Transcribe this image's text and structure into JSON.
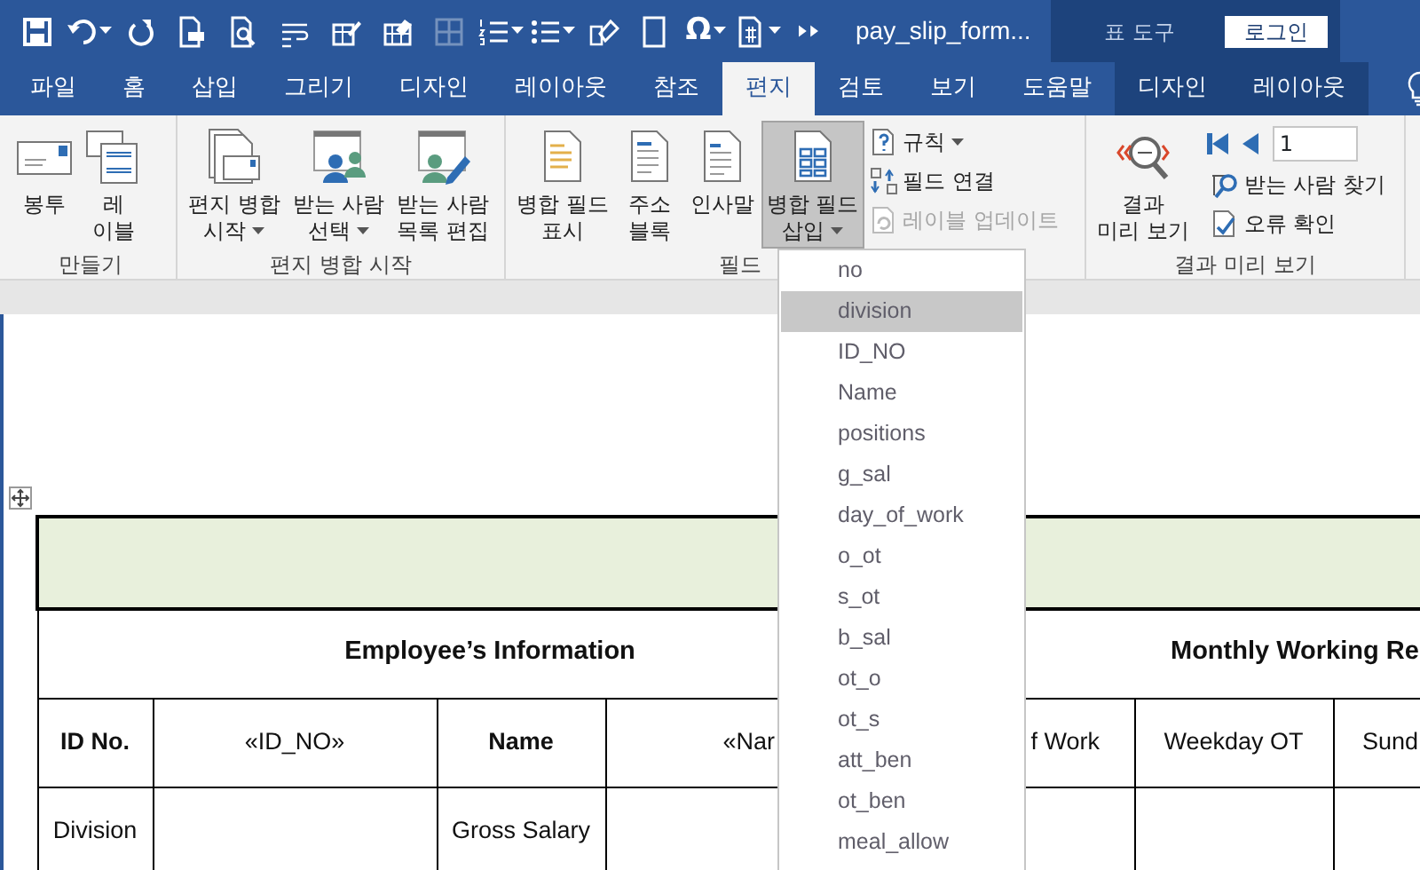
{
  "window": {
    "title": "pay_slip_form...",
    "context_label": "표 도구",
    "login_button": "로그인",
    "symbol_button": "Ω"
  },
  "quick_access": [
    {
      "kind": "save",
      "dropdown": false,
      "disabled": false
    },
    {
      "kind": "undo",
      "dropdown": true,
      "disabled": false
    },
    {
      "kind": "redo",
      "dropdown": false,
      "disabled": false
    },
    {
      "kind": "print-doc",
      "dropdown": false,
      "disabled": false
    },
    {
      "kind": "preview",
      "dropdown": false,
      "disabled": false
    },
    {
      "kind": "wrap",
      "dropdown": false,
      "disabled": false
    },
    {
      "kind": "table-pen",
      "dropdown": false,
      "disabled": false
    },
    {
      "kind": "table-eraser",
      "dropdown": false,
      "disabled": false
    },
    {
      "kind": "table-grid",
      "dropdown": false,
      "disabled": true
    },
    {
      "kind": "numbered-list",
      "dropdown": true,
      "disabled": false
    },
    {
      "kind": "bullet-list",
      "dropdown": true,
      "disabled": false
    },
    {
      "kind": "shape-eraser",
      "dropdown": false,
      "disabled": false
    },
    {
      "kind": "doc-box",
      "dropdown": false,
      "disabled": false
    },
    {
      "kind": "symbol",
      "dropdown": true,
      "disabled": false
    },
    {
      "kind": "doc-number",
      "dropdown": true,
      "disabled": false
    },
    {
      "kind": "more",
      "dropdown": false,
      "disabled": false
    }
  ],
  "tabs": [
    {
      "label": "파일",
      "selected": false,
      "contextual": false
    },
    {
      "label": "홈",
      "selected": false,
      "contextual": false
    },
    {
      "label": "삽입",
      "selected": false,
      "contextual": false
    },
    {
      "label": "그리기",
      "selected": false,
      "contextual": false
    },
    {
      "label": "디자인",
      "selected": false,
      "contextual": false
    },
    {
      "label": "레이아웃",
      "selected": false,
      "contextual": false
    },
    {
      "label": "참조",
      "selected": false,
      "contextual": false
    },
    {
      "label": "편지",
      "selected": true,
      "contextual": false
    },
    {
      "label": "검토",
      "selected": false,
      "contextual": false
    },
    {
      "label": "보기",
      "selected": false,
      "contextual": false
    },
    {
      "label": "도움말",
      "selected": false,
      "contextual": false
    },
    {
      "label": "디자인",
      "selected": false,
      "contextual": true
    },
    {
      "label": "레이아웃",
      "selected": false,
      "contextual": true
    }
  ],
  "ribbon_groups": [
    {
      "label": "만들기",
      "large": [
        {
          "kind": "envelope",
          "lines": [
            "봉투"
          ],
          "dropdown": false,
          "pressed": false
        },
        {
          "kind": "labels",
          "lines": [
            "레",
            "이블"
          ],
          "dropdown": false,
          "pressed": false
        }
      ]
    },
    {
      "label": "편지 병합 시작",
      "large": [
        {
          "kind": "mail-merge",
          "lines": [
            "편지 병합",
            "시작"
          ],
          "dropdown": true,
          "pressed": false
        },
        {
          "kind": "select-recipients",
          "lines": [
            "받는 사람",
            "선택"
          ],
          "dropdown": true,
          "pressed": false
        },
        {
          "kind": "edit-recipients",
          "lines": [
            "받는 사람",
            "목록 편집"
          ],
          "dropdown": false,
          "pressed": false
        }
      ]
    },
    {
      "label": "필드",
      "large": [
        {
          "kind": "highlight-fields",
          "lines": [
            "병합 필드",
            "표시"
          ],
          "dropdown": false,
          "pressed": false
        },
        {
          "kind": "address-block",
          "lines": [
            "주소",
            "블록"
          ],
          "dropdown": false,
          "pressed": false
        },
        {
          "kind": "greeting",
          "lines": [
            "인사말"
          ],
          "dropdown": false,
          "pressed": false
        },
        {
          "kind": "insert-field",
          "lines": [
            "병합 필드",
            "삽입"
          ],
          "dropdown": true,
          "pressed": true
        }
      ],
      "small": [
        {
          "kind": "rules",
          "label": "규칙",
          "dropdown": true,
          "disabled": false
        },
        {
          "kind": "match-fields",
          "label": "필드 연결",
          "dropdown": false,
          "disabled": false
        },
        {
          "kind": "update-labels",
          "label": "레이블 업데이트",
          "dropdown": false,
          "disabled": true
        }
      ]
    },
    {
      "label": "결과 미리 보기",
      "large": [
        {
          "kind": "preview-results",
          "lines": [
            "결과",
            "미리 보기"
          ],
          "dropdown": false,
          "pressed": false
        }
      ],
      "record_field": {
        "value": "1"
      },
      "small": [
        {
          "kind": "find-recipient",
          "label": "받는 사람 찾기",
          "dropdown": false,
          "disabled": false
        },
        {
          "kind": "check-errors",
          "label": "오류 확인",
          "dropdown": false,
          "disabled": false
        }
      ]
    }
  ],
  "merge_field_menu": [
    {
      "label": "no",
      "selected": false
    },
    {
      "label": "division",
      "selected": true
    },
    {
      "label": "ID_NO",
      "selected": false
    },
    {
      "label": "Name",
      "selected": false
    },
    {
      "label": "positions",
      "selected": false
    },
    {
      "label": "g_sal",
      "selected": false
    },
    {
      "label": "day_of_work",
      "selected": false
    },
    {
      "label": "o_ot",
      "selected": false
    },
    {
      "label": "s_ot",
      "selected": false
    },
    {
      "label": "b_sal",
      "selected": false
    },
    {
      "label": "ot_o",
      "selected": false
    },
    {
      "label": "ot_s",
      "selected": false
    },
    {
      "label": "att_ben",
      "selected": false
    },
    {
      "label": "ot_ben",
      "selected": false
    },
    {
      "label": "meal_allow",
      "selected": false
    }
  ],
  "document_table": {
    "rows": [
      [
        {
          "colspan": 7,
          "shaded": true
        }
      ],
      [
        {
          "text": "Employee’s Information",
          "bold": true,
          "colspan": 4
        },
        {
          "text": "Monthly Working Re",
          "bold": true,
          "colspan": 3
        }
      ],
      [
        {
          "text": "ID No.",
          "bold": true
        },
        {
          "text": "«ID_NO»",
          "bold": false
        },
        {
          "text": "Name",
          "bold": true
        },
        {
          "text": "«Nar",
          "bold": false
        },
        {
          "text": "f Work",
          "bold": false
        },
        {
          "text": "Weekday OT",
          "bold": false
        },
        {
          "text": "Sund",
          "bold": false
        }
      ],
      [
        {
          "text": "Division",
          "bold": false
        },
        {},
        {
          "text": "Gross Salary",
          "bold": false
        },
        {},
        {},
        {},
        {}
      ]
    ]
  }
}
